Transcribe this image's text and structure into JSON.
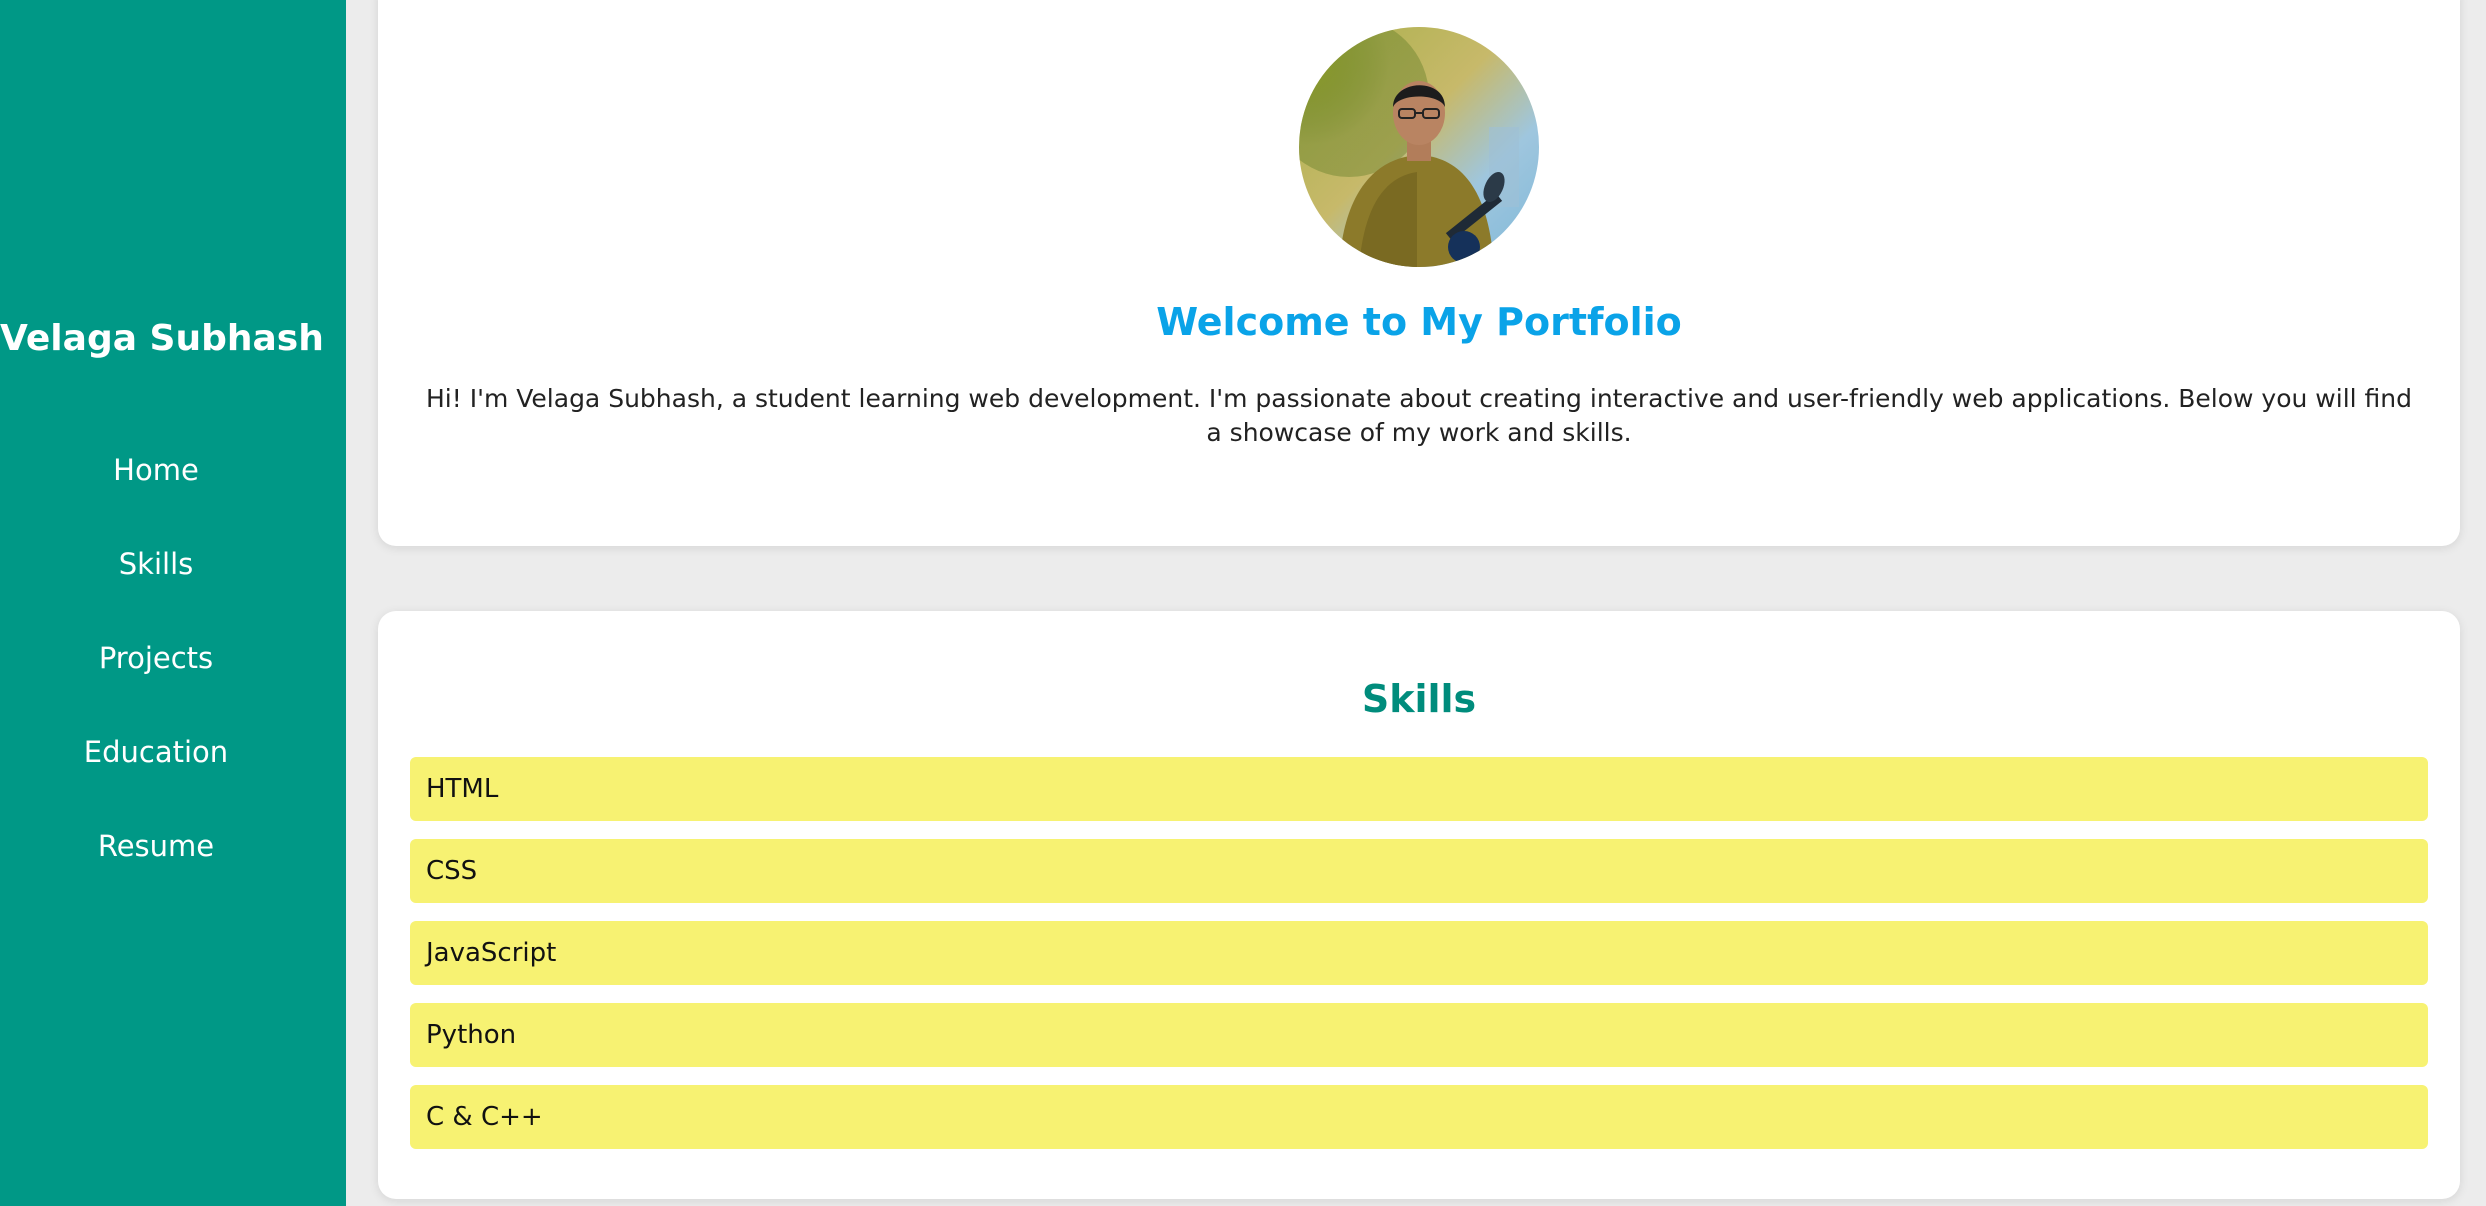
{
  "sidebar": {
    "brand": "Velaga Subhash",
    "items": [
      {
        "label": "Home"
      },
      {
        "label": "Skills"
      },
      {
        "label": "Projects"
      },
      {
        "label": "Education"
      },
      {
        "label": "Resume"
      }
    ]
  },
  "hero": {
    "avatar": "profile-photo",
    "title": "Welcome to My Portfolio",
    "text": "Hi! I'm Velaga Subhash, a student learning web development. I'm passionate about creating interactive and user-friendly web applications. Below you will find a showcase of my work and skills."
  },
  "skills": {
    "title": "Skills",
    "items": [
      {
        "label": "HTML"
      },
      {
        "label": "CSS"
      },
      {
        "label": "JavaScript"
      },
      {
        "label": "Python"
      },
      {
        "label": "C & C++"
      }
    ]
  },
  "colors": {
    "sidebar": "#009886",
    "hero_title": "#0aa3e8",
    "skills_title": "#008c7c",
    "skill_bar": "#f7f272",
    "background": "#ececec"
  }
}
